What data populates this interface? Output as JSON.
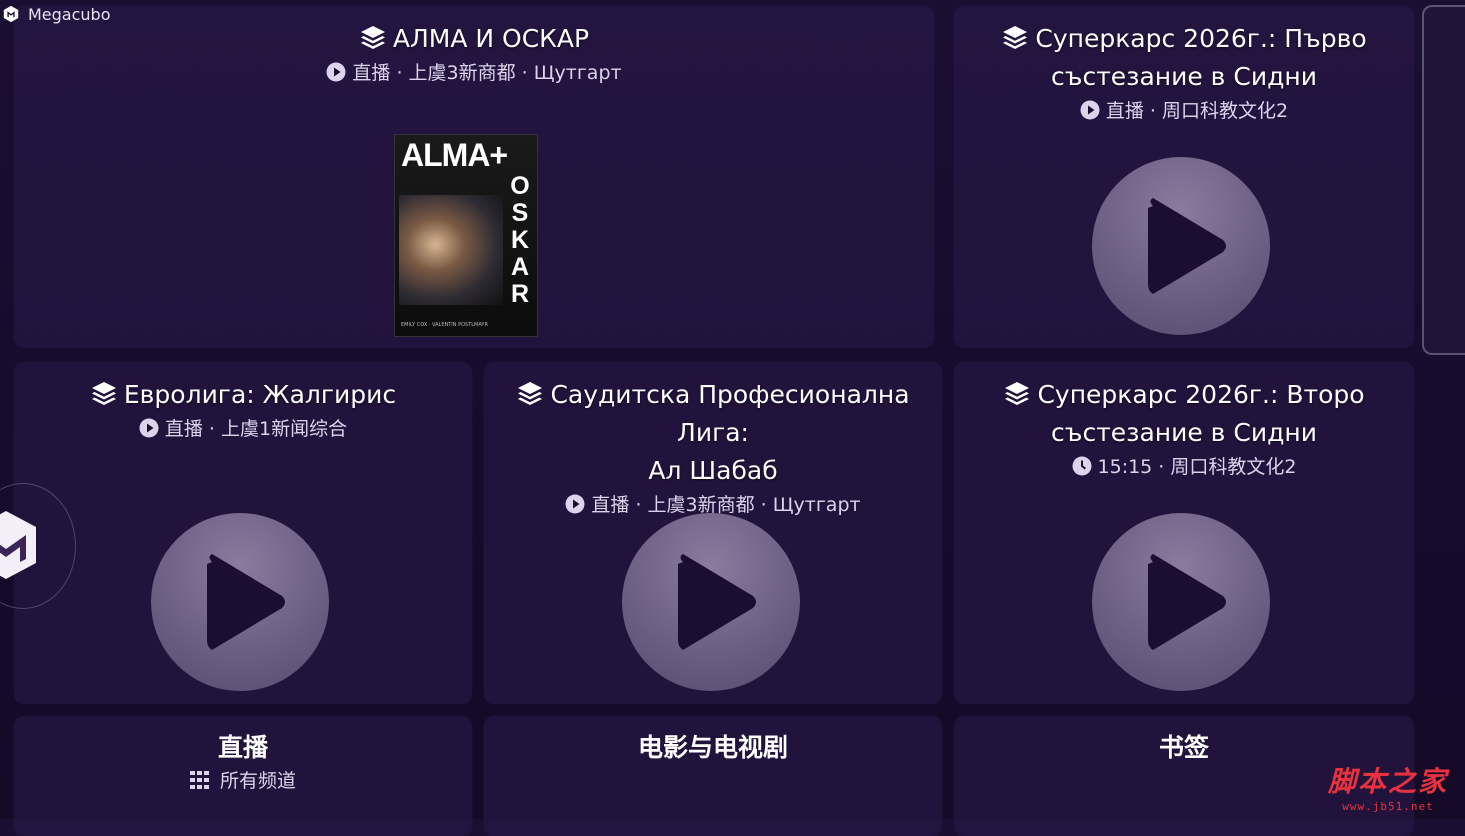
{
  "app": {
    "title": "Megacubo"
  },
  "cards": [
    {
      "id": "alma",
      "title": "АЛМА И ОСКАР",
      "sub_icon": "play-circle-icon",
      "subtitle": "直播 · 上虞3新商都 · Щутгарт"
    },
    {
      "id": "supercars1",
      "title_line1": "Суперкарс 2026г.: Първо",
      "title_line2": "състезание в Сидни",
      "sub_icon": "play-circle-icon",
      "subtitle": "直播 · 周口科教文化2"
    },
    {
      "id": "euroleague",
      "title": "Евролига: Жалгирис",
      "sub_icon": "play-circle-icon",
      "subtitle": "直播 · 上虞1新闻综合"
    },
    {
      "id": "saudi",
      "title_line1": "Саудитска Професионална Лига:",
      "title_line2": "Ал Шабаб",
      "sub_icon": "play-circle-icon",
      "subtitle": "直播 · 上虞3新商都 · Щутгарт"
    },
    {
      "id": "supercars2",
      "title_line1": "Суперкарс 2026г.: Второ",
      "title_line2": "състезание в Сидни",
      "sub_icon": "clock-icon",
      "subtitle": "15:15 · 周口科教文化2"
    }
  ],
  "poster": {
    "top_text": "ALMA+",
    "side_text": "OSKAR",
    "caption": "EMILY COX · VALENTIN POSTLMAYR"
  },
  "bottom": [
    {
      "title": "直播",
      "subtitle": "所有频道",
      "icon": "grid-icon"
    },
    {
      "title": "电影与电视剧"
    },
    {
      "title": "书签"
    }
  ],
  "watermark": {
    "main": "脚本之家",
    "url": "www.jb51.net"
  },
  "colors": {
    "background": "#1b0e33",
    "card": "#2c1c4a",
    "play_button": "#6f6284",
    "watermark": "#e8323f"
  }
}
